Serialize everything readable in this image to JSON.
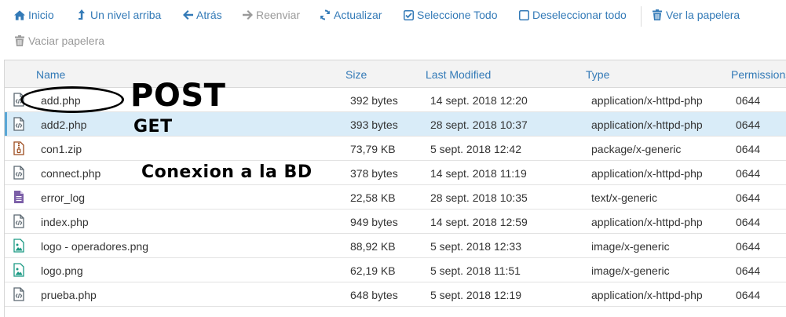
{
  "toolbar": {
    "home": "Inicio",
    "up": "Un nivel arriba",
    "back": "Atrás",
    "forward": "Reenviar",
    "reload": "Actualizar",
    "select_all": "Seleccione Todo",
    "deselect_all": "Deseleccionar todo",
    "view_trash": "Ver la papelera",
    "empty_trash": "Vaciar papelera"
  },
  "columns": {
    "name": "Name",
    "size": "Size",
    "modified": "Last Modified",
    "type": "Type",
    "permissions": "Permissions"
  },
  "files": [
    {
      "name": "add.php",
      "size": "392 bytes",
      "modified": "14 sept. 2018 12:20",
      "type": "application/x-httpd-php",
      "perm": "0644",
      "icon": "php-file-icon"
    },
    {
      "name": "add2.php",
      "size": "393 bytes",
      "modified": "28 sept. 2018 10:37",
      "type": "application/x-httpd-php",
      "perm": "0644",
      "icon": "php-file-icon"
    },
    {
      "name": "con1.zip",
      "size": "73,79 KB",
      "modified": "5 sept. 2018 12:42",
      "type": "package/x-generic",
      "perm": "0644",
      "icon": "zip-file-icon"
    },
    {
      "name": "connect.php",
      "size": "378 bytes",
      "modified": "14 sept. 2018 11:19",
      "type": "application/x-httpd-php",
      "perm": "0644",
      "icon": "php-file-icon"
    },
    {
      "name": "error_log",
      "size": "22,58 KB",
      "modified": "28 sept. 2018 10:35",
      "type": "text/x-generic",
      "perm": "0644",
      "icon": "text-file-icon"
    },
    {
      "name": "index.php",
      "size": "949 bytes",
      "modified": "14 sept. 2018 12:59",
      "type": "application/x-httpd-php",
      "perm": "0644",
      "icon": "php-file-icon"
    },
    {
      "name": "logo - operadores.png",
      "size": "88,92 KB",
      "modified": "5 sept. 2018 12:33",
      "type": "image/x-generic",
      "perm": "0644",
      "icon": "image-file-icon"
    },
    {
      "name": "logo.png",
      "size": "62,19 KB",
      "modified": "5 sept. 2018 11:51",
      "type": "image/x-generic",
      "perm": "0644",
      "icon": "image-file-icon"
    },
    {
      "name": "prueba.php",
      "size": "648 bytes",
      "modified": "5 sept. 2018 12:19",
      "type": "application/x-httpd-php",
      "perm": "0644",
      "icon": "php-file-icon"
    }
  ],
  "selected_row": 1,
  "annotations": {
    "post": "POST",
    "get": "GET",
    "db": "Conexion a la BD"
  },
  "colors": {
    "link": "#337ab7",
    "selected_row": "#d9ecf8",
    "php_icon": "#5b6770",
    "zip_icon": "#9c4a1c",
    "text_icon": "#7b5ea7",
    "image_icon": "#1b9a84"
  }
}
